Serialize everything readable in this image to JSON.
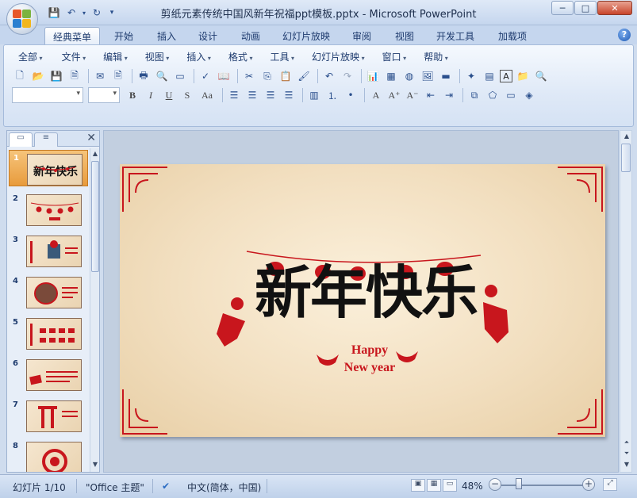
{
  "window": {
    "title": "剪纸元素传统中国风新年祝福ppt模板.pptx - Microsoft PowerPoint",
    "controls": {
      "minimize": "─",
      "maximize": "□",
      "close": "✕"
    }
  },
  "ribbon_tabs": [
    "经典菜单",
    "开始",
    "插入",
    "设计",
    "动画",
    "幻灯片放映",
    "审阅",
    "视图",
    "开发工具",
    "加载项"
  ],
  "classic_menu": [
    "全部",
    "文件",
    "编辑",
    "视图",
    "插入",
    "格式",
    "工具",
    "幻灯片放映",
    "窗口",
    "帮助"
  ],
  "format_buttons": {
    "bold": "B",
    "italic": "I",
    "underline": "U",
    "shadow": "S",
    "case": "Aa"
  },
  "panel": {
    "close_glyph": "✕",
    "slides": [
      {
        "num": "1",
        "selected": true
      },
      {
        "num": "2",
        "selected": false
      },
      {
        "num": "3",
        "selected": false
      },
      {
        "num": "4",
        "selected": false
      },
      {
        "num": "5",
        "selected": false
      },
      {
        "num": "6",
        "selected": false
      },
      {
        "num": "7",
        "selected": false
      },
      {
        "num": "8",
        "selected": false
      }
    ]
  },
  "slide": {
    "big_title": "新年快乐",
    "subtitle_line1": "Happy",
    "subtitle_line2": "New year",
    "colors": {
      "red": "#c8161d",
      "black": "#111111",
      "paper": "#f2dfc0"
    }
  },
  "status": {
    "slide_counter": "幻灯片 1/10",
    "theme": "\"Office 主题\"",
    "language": "中文(简体，中国)",
    "zoom": "48%"
  }
}
